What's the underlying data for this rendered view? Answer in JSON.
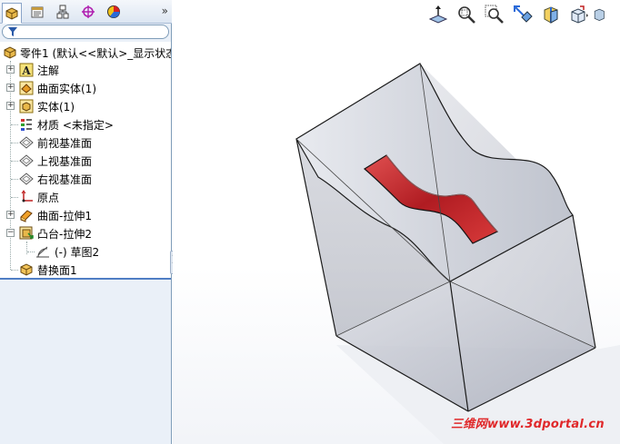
{
  "panel": {
    "tabs": [
      {
        "icon": "feature-manager-icon",
        "active": true
      },
      {
        "icon": "property-manager-icon",
        "active": false
      },
      {
        "icon": "configuration-manager-icon",
        "active": false
      },
      {
        "icon": "dimxpert-manager-icon",
        "active": false
      },
      {
        "icon": "display-manager-icon",
        "active": false
      }
    ],
    "more_label": "»",
    "root_label": "零件1  (默认<<默认>_显示状态",
    "tree": [
      {
        "label": "注解",
        "icon": "annotations-icon",
        "expander": "+"
      },
      {
        "label": "曲面实体(1)",
        "icon": "surface-bodies-icon",
        "expander": "+"
      },
      {
        "label": "实体(1)",
        "icon": "solid-bodies-icon",
        "expander": "+"
      },
      {
        "label": "材质 <未指定>",
        "icon": "material-icon",
        "expander": ""
      },
      {
        "label": "前视基准面",
        "icon": "plane-icon",
        "expander": ""
      },
      {
        "label": "上视基准面",
        "icon": "plane-icon",
        "expander": ""
      },
      {
        "label": "右视基准面",
        "icon": "plane-icon",
        "expander": ""
      },
      {
        "label": "原点",
        "icon": "origin-icon",
        "expander": ""
      },
      {
        "label": "曲面-拉伸1",
        "icon": "surface-extrude-icon",
        "expander": "+"
      },
      {
        "label": "凸台-拉伸2",
        "icon": "boss-extrude-icon",
        "expander": "−"
      },
      {
        "label": "(-) 草图2",
        "icon": "sketch-icon",
        "expander": ""
      },
      {
        "label": "替换面1",
        "icon": "replace-face-icon",
        "expander": ""
      }
    ]
  },
  "view_toolbar": [
    {
      "icon": "normal-to-icon"
    },
    {
      "icon": "zoom-to-fit-icon"
    },
    {
      "icon": "zoom-to-area-icon"
    },
    {
      "icon": "previous-view-icon"
    },
    {
      "icon": "section-view-icon"
    },
    {
      "icon": "view-orientation-icon"
    },
    {
      "icon": "display-style-icon"
    }
  ],
  "watermark": "三维网www.3dportal.cn",
  "colors": {
    "panel_bg": "#eaf0f8",
    "accent_blue": "#4f7ec4",
    "face_red": "#c8252a",
    "model_edge": "#1a1a1a"
  }
}
